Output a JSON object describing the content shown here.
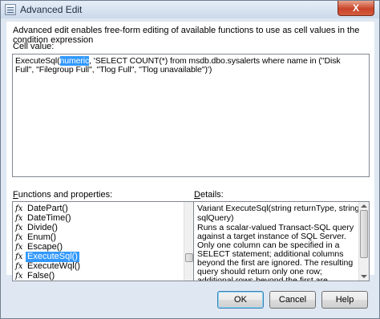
{
  "window": {
    "title": "Advanced Edit",
    "close_glyph": "X"
  },
  "description": "Advanced edit enables free-form editing of available functions to use as cell values in the condition expression",
  "cell_value": {
    "label": "Cell value:",
    "text_before": "ExecuteSql(",
    "selected": "numeric",
    "text_after": ", 'SELECT COUNT(*) from msdb.dbo.sysalerts where name in (''Disk Full'', ''Filegroup Full'', ''Tlog Full'', ''Tlog unavailable'')')"
  },
  "functions": {
    "label_prefix": "F",
    "label_rest": "unctions and properties:",
    "icon_glyph": "fx",
    "items": [
      {
        "name": "DatePart()",
        "selected": false
      },
      {
        "name": "DateTime()",
        "selected": false
      },
      {
        "name": "Divide()",
        "selected": false
      },
      {
        "name": "Enum()",
        "selected": false
      },
      {
        "name": "Escape()",
        "selected": false
      },
      {
        "name": "ExecuteSql()",
        "selected": true
      },
      {
        "name": "ExecuteWql()",
        "selected": false
      },
      {
        "name": "False()",
        "selected": false
      }
    ]
  },
  "details": {
    "label_prefix": "D",
    "label_rest": "etails:",
    "signature": "Variant ExecuteSql(string returnType, string sqlQuery)",
    "description": "Runs a scalar-valued Transact-SQL query against a target instance of SQL Server. Only one column can be specified in a SELECT statement; additional columns beyond the first are ignored. The resulting query should return only one row; additional rows beyond the first are ignored. If the query returns an empty set or NULL, then the condition expression built around"
  },
  "buttons": {
    "ok": "OK",
    "cancel": "Cancel",
    "help": "Help"
  }
}
